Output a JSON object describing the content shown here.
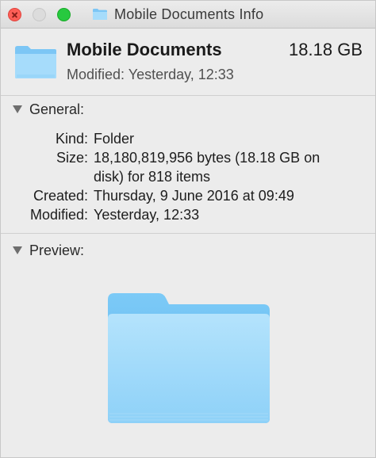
{
  "window": {
    "title": "Mobile Documents Info"
  },
  "header": {
    "name": "Mobile Documents",
    "size": "18.18 GB",
    "modified": "Modified: Yesterday, 12:33"
  },
  "general": {
    "title": "General:",
    "rows": [
      {
        "label": "Kind:",
        "value": "Folder"
      },
      {
        "label": "Size:",
        "value": "18,180,819,956 bytes (18.18 GB on",
        "value2": "disk) for 818 items"
      },
      {
        "label": "Created:",
        "value": "Thursday, 9 June 2016 at 09:49"
      },
      {
        "label": "Modified:",
        "value": "Yesterday, 12:33"
      }
    ]
  },
  "preview": {
    "title": "Preview:"
  },
  "icons": {
    "close": "close-icon",
    "minimize": "minimize-icon",
    "zoom": "zoom-icon",
    "folder": "folder-icon",
    "disclosure": "disclosure-triangle-icon"
  },
  "colors": {
    "folder_light": "#a6dcfb",
    "folder_mid": "#7cc6f5",
    "folder_dark": "#5cb3ea",
    "close": "#fd5f57",
    "zoom": "#27c93f"
  }
}
